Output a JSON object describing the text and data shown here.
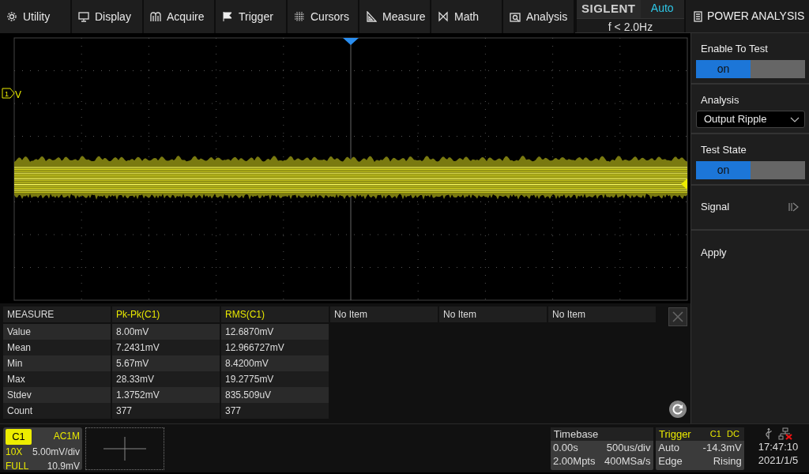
{
  "menu": [
    {
      "label": "Utility"
    },
    {
      "label": "Display"
    },
    {
      "label": "Acquire"
    },
    {
      "label": "Trigger"
    },
    {
      "label": "Cursors"
    },
    {
      "label": "Measure"
    },
    {
      "label": "Math"
    },
    {
      "label": "Analysis"
    }
  ],
  "brand": {
    "logo": "SIGLENT",
    "mode": "Auto",
    "frequency": "f < 2.0Hz"
  },
  "panel": {
    "title": "POWER ANALYSIS",
    "items": [
      {
        "kind": "toggle",
        "label": "Enable To Test",
        "value": "on",
        "on": true
      },
      {
        "kind": "select",
        "label": "Analysis",
        "value": "Output Ripple"
      },
      {
        "kind": "toggle",
        "label": "Test State",
        "value": "on",
        "on": true
      },
      {
        "kind": "submenu",
        "label": "Signal"
      },
      {
        "kind": "action",
        "label": "Apply"
      }
    ]
  },
  "scope": {
    "channel_marker": "1",
    "channel_label": "V"
  },
  "measure": {
    "columns": [
      "MEASURE",
      "Pk-Pk(C1)",
      "RMS(C1)",
      "No Item",
      "No Item",
      "No Item"
    ],
    "rows": [
      {
        "label": "Value",
        "values": [
          "8.00mV",
          "12.6870mV"
        ]
      },
      {
        "label": "Mean",
        "values": [
          "7.2431mV",
          "12.966727mV"
        ]
      },
      {
        "label": "Min",
        "values": [
          "5.67mV",
          "8.4200mV"
        ]
      },
      {
        "label": "Max",
        "values": [
          "28.33mV",
          "19.2775mV"
        ]
      },
      {
        "label": "Stdev",
        "values": [
          "1.3752mV",
          "835.509uV"
        ]
      },
      {
        "label": "Count",
        "values": [
          "377",
          "377"
        ]
      }
    ]
  },
  "channel": {
    "name": "C1",
    "coupling": "AC1M",
    "probe": "10X",
    "scale": "5.00mV/div",
    "bandwidth": "FULL",
    "offset": "10.9mV"
  },
  "timebase": {
    "title": "Timebase",
    "delay": "0.00s",
    "scale": "500us/div",
    "memory": "2.00Mpts",
    "rate": "400MSa/s"
  },
  "trigger": {
    "title": "Trigger",
    "source": "C1",
    "coupling": "DC",
    "mode": "Auto",
    "level": "-14.3mV",
    "type": "Edge",
    "slope": "Rising"
  },
  "clock": {
    "time": "17:47:10",
    "date": "2021/1/5"
  }
}
